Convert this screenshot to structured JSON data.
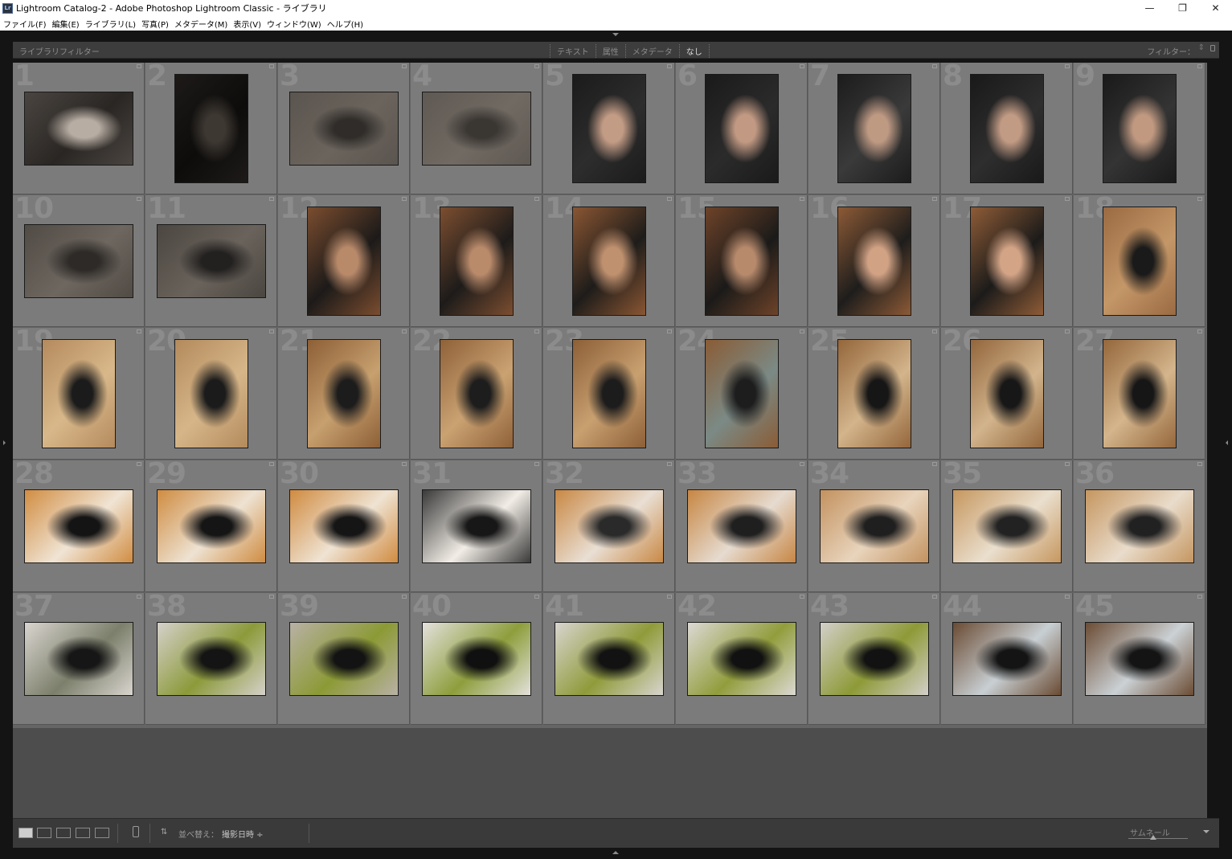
{
  "window": {
    "app_icon": "Lr",
    "title": "Lightroom Catalog-2 - Adobe Photoshop Lightroom Classic - ライブラリ",
    "controls": [
      "minimize-icon",
      "restore-icon",
      "close-icon"
    ]
  },
  "menu": [
    "ファイル(F)",
    "編集(E)",
    "ライブラリ(L)",
    "写真(P)",
    "メタデータ(M)",
    "表示(V)",
    "ウィンドウ(W)",
    "ヘルプ(H)"
  ],
  "filter_bar": {
    "title": "ライブラリフィルター",
    "tabs": [
      "テキスト",
      "属性",
      "メタデータ",
      "なし"
    ],
    "active_tab": "なし",
    "preset_label": "フィルター：",
    "lock_icon": "lock-icon"
  },
  "grid": {
    "cells": [
      {
        "num": "1",
        "orient": "l",
        "colors": [
          "#4a4541",
          "#b7ada3",
          "#2a2623"
        ]
      },
      {
        "num": "2",
        "orient": "p",
        "colors": [
          "#1d1a18",
          "#3e3832",
          "#0d0c0b"
        ]
      },
      {
        "num": "3",
        "orient": "l",
        "colors": [
          "#5b554f",
          "#2f2c29",
          "#6b645d"
        ]
      },
      {
        "num": "4",
        "orient": "l",
        "colors": [
          "#5f5953",
          "#3a3632",
          "#716a63"
        ]
      },
      {
        "num": "5",
        "orient": "p",
        "colors": [
          "#1b1b1b",
          "#c39c85",
          "#2d2d2d"
        ]
      },
      {
        "num": "6",
        "orient": "p",
        "colors": [
          "#1a1a1a",
          "#c29a83",
          "#2b2b2b"
        ]
      },
      {
        "num": "7",
        "orient": "p",
        "colors": [
          "#1c1c1c",
          "#bf9a83",
          "#3a3a3a"
        ]
      },
      {
        "num": "8",
        "orient": "p",
        "colors": [
          "#191919",
          "#c29b84",
          "#2e2e2e"
        ]
      },
      {
        "num": "9",
        "orient": "p",
        "colors": [
          "#1a1a1a",
          "#c09980",
          "#343434"
        ]
      },
      {
        "num": "10",
        "orient": "l",
        "colors": [
          "#514b45",
          "#2d2a27",
          "#6e6760"
        ]
      },
      {
        "num": "11",
        "orient": "l",
        "colors": [
          "#4b4640",
          "#232120",
          "#6a635c"
        ]
      },
      {
        "num": "12",
        "orient": "p",
        "colors": [
          "#7b4d2f",
          "#b98a6a",
          "#1c1a19"
        ]
      },
      {
        "num": "13",
        "orient": "p",
        "colors": [
          "#7c4e30",
          "#ba8b6b",
          "#1d1b1a"
        ]
      },
      {
        "num": "14",
        "orient": "p",
        "colors": [
          "#8a5633",
          "#c0916f",
          "#1e1c1a"
        ]
      },
      {
        "num": "15",
        "orient": "p",
        "colors": [
          "#6e4329",
          "#b78a6c",
          "#1b1a19"
        ]
      },
      {
        "num": "16",
        "orient": "p",
        "colors": [
          "#8c5a36",
          "#d1a284",
          "#1e1d1c"
        ]
      },
      {
        "num": "17",
        "orient": "p",
        "colors": [
          "#8f5c37",
          "#d3a486",
          "#1c1b1a"
        ]
      },
      {
        "num": "18",
        "orient": "p",
        "colors": [
          "#9a6a42",
          "#1a1a1a",
          "#c49768"
        ]
      },
      {
        "num": "19",
        "orient": "p",
        "colors": [
          "#b48a5d",
          "#1b1b1b",
          "#d8b88a"
        ]
      },
      {
        "num": "20",
        "orient": "p",
        "colors": [
          "#b38a5c",
          "#1b1b1b",
          "#d6b689"
        ]
      },
      {
        "num": "21",
        "orient": "p",
        "colors": [
          "#8d5f36",
          "#1c1c1c",
          "#c7a06f"
        ]
      },
      {
        "num": "22",
        "orient": "p",
        "colors": [
          "#8f6138",
          "#1d1d1d",
          "#caa272"
        ]
      },
      {
        "num": "23",
        "orient": "p",
        "colors": [
          "#8d5f37",
          "#1c1c1c",
          "#c8a070"
        ]
      },
      {
        "num": "24",
        "orient": "p",
        "colors": [
          "#8a5c35",
          "#1d1d1d",
          "#7b8a86"
        ]
      },
      {
        "num": "25",
        "orient": "p",
        "colors": [
          "#94663b",
          "#161616",
          "#d3b48b"
        ]
      },
      {
        "num": "26",
        "orient": "p",
        "colors": [
          "#93663c",
          "#171717",
          "#d2b48c"
        ]
      },
      {
        "num": "27",
        "orient": "p",
        "colors": [
          "#95673c",
          "#161616",
          "#d4b58c"
        ]
      },
      {
        "num": "28",
        "orient": "l",
        "colors": [
          "#d18d42",
          "#141414",
          "#f0e4d4"
        ]
      },
      {
        "num": "29",
        "orient": "l",
        "colors": [
          "#cf8c41",
          "#151515",
          "#eee2d2"
        ]
      },
      {
        "num": "30",
        "orient": "l",
        "colors": [
          "#d08b40",
          "#151515",
          "#efe3d3"
        ]
      },
      {
        "num": "31",
        "orient": "l",
        "colors": [
          "#3a3a3a",
          "#171717",
          "#f2ede6"
        ]
      },
      {
        "num": "32",
        "orient": "l",
        "colors": [
          "#c98844",
          "#2a2a2a",
          "#e9dfd4"
        ]
      },
      {
        "num": "33",
        "orient": "l",
        "colors": [
          "#c78643",
          "#1f1f1f",
          "#e6dbd0"
        ]
      },
      {
        "num": "34",
        "orient": "l",
        "colors": [
          "#c3925f",
          "#1f1f1f",
          "#e8d4bc"
        ]
      },
      {
        "num": "35",
        "orient": "l",
        "colors": [
          "#c6975f",
          "#222222",
          "#eadfce"
        ]
      },
      {
        "num": "36",
        "orient": "l",
        "colors": [
          "#c59660",
          "#212121",
          "#e9dccb"
        ]
      },
      {
        "num": "37",
        "orient": "l",
        "colors": [
          "#d9d5cf",
          "#161616",
          "#7c7f6b"
        ]
      },
      {
        "num": "38",
        "orient": "l",
        "colors": [
          "#d5d1cb",
          "#141414",
          "#8c9a3a"
        ]
      },
      {
        "num": "39",
        "orient": "l",
        "colors": [
          "#b8b1a5",
          "#131313",
          "#8c9a35"
        ]
      },
      {
        "num": "40",
        "orient": "l",
        "colors": [
          "#e4e1dc",
          "#101010",
          "#8d9e3c"
        ]
      },
      {
        "num": "41",
        "orient": "l",
        "colors": [
          "#d8d5cf",
          "#121212",
          "#8f9b3a"
        ]
      },
      {
        "num": "42",
        "orient": "l",
        "colors": [
          "#dcd9d4",
          "#111111",
          "#919d3c"
        ]
      },
      {
        "num": "43",
        "orient": "l",
        "colors": [
          "#d3cfc9",
          "#121212",
          "#8d9a37"
        ]
      },
      {
        "num": "44",
        "orient": "l",
        "colors": [
          "#6a4b33",
          "#141414",
          "#c8cfd3"
        ]
      },
      {
        "num": "45",
        "orient": "l",
        "colors": [
          "#6b4c34",
          "#141414",
          "#cbd1d5"
        ]
      }
    ]
  },
  "toolbar": {
    "view_modes": [
      "grid-view-icon",
      "loupe-view-icon",
      "compare-view-icon",
      "survey-view-icon",
      "people-view-icon"
    ],
    "active_view": "grid-view-icon",
    "painter_icon": "spray-can-icon",
    "sort_direction_icon": "sort-direction-icon",
    "sort_label": "並べ替え：",
    "sort_value": "撮影日時 ÷",
    "thumbnail_label": "サムネール",
    "thumbnail_size": 0.42
  }
}
